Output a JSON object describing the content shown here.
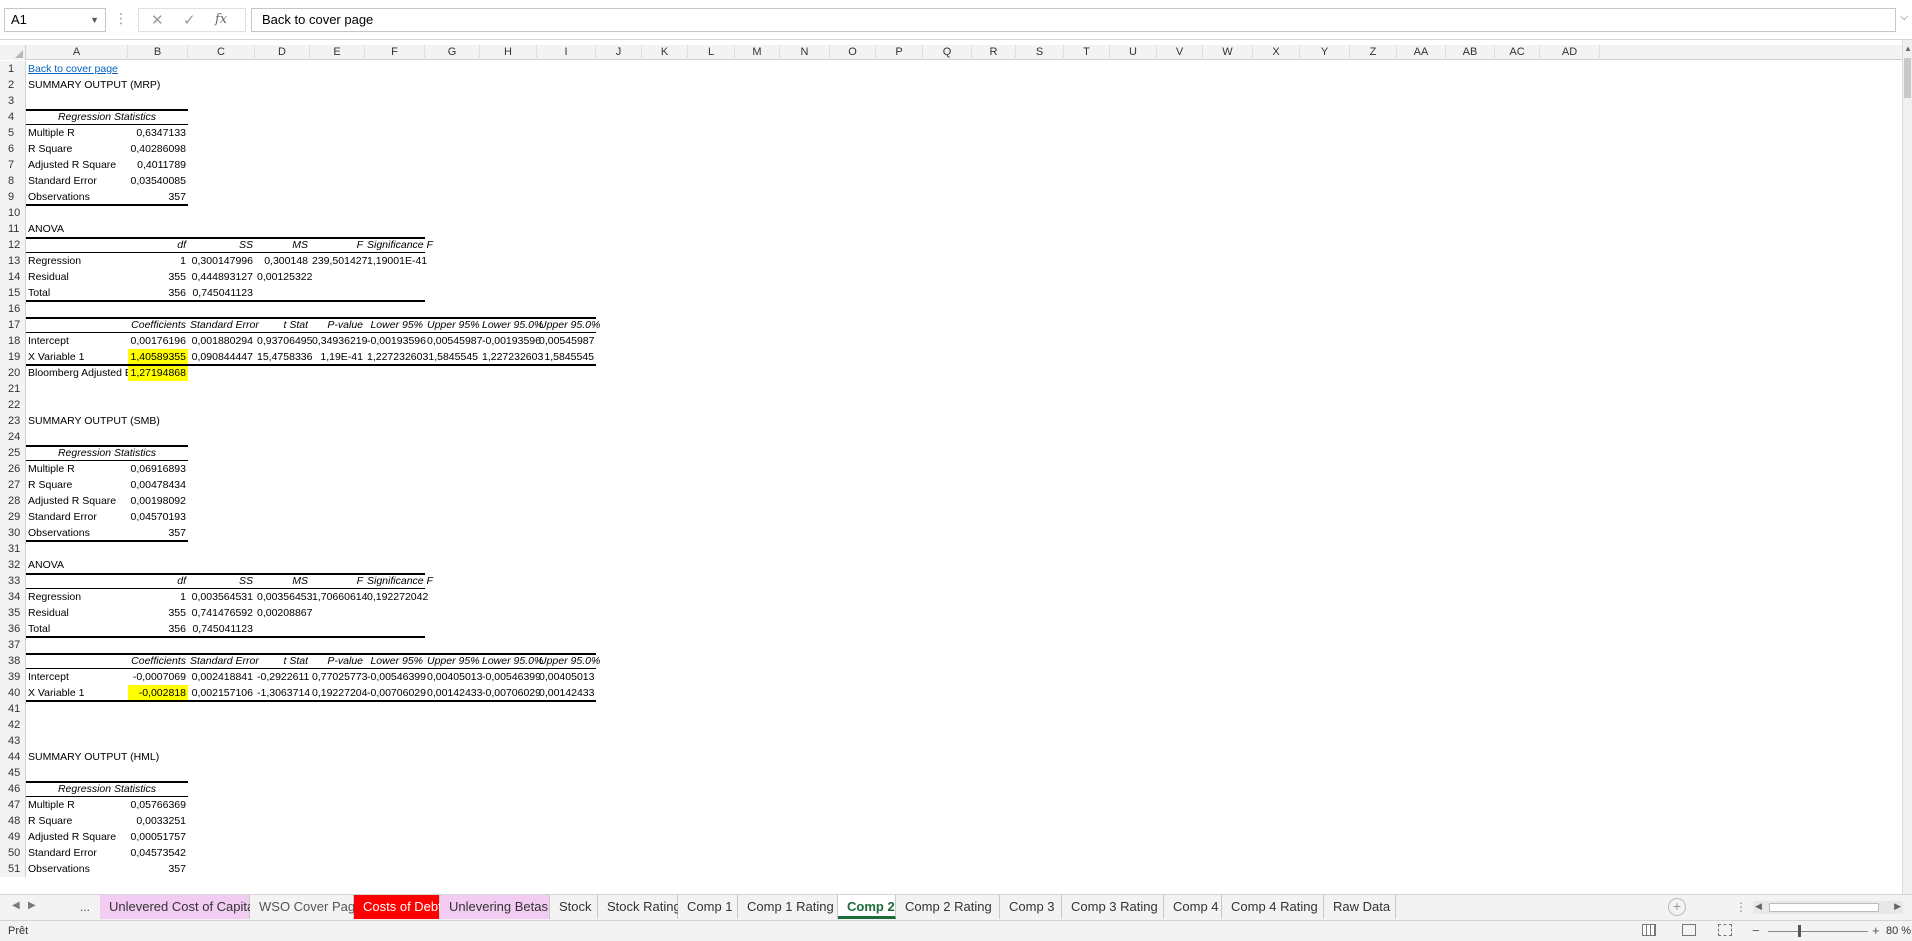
{
  "formula_bar": {
    "name_box": "A1",
    "fx_symbol": "fx",
    "formula": "Back to cover page"
  },
  "columns": [
    "A",
    "B",
    "C",
    "D",
    "E",
    "F",
    "G",
    "H",
    "I",
    "J",
    "K",
    "L",
    "M",
    "N",
    "O",
    "P",
    "Q",
    "R",
    "S",
    "T",
    "U",
    "V",
    "W",
    "X",
    "Y",
    "Z",
    "AA",
    "AB",
    "AC",
    "AD"
  ],
  "rows": [
    "1",
    "2",
    "3",
    "4",
    "5",
    "6",
    "7",
    "8",
    "9",
    "10",
    "11",
    "12",
    "13",
    "14",
    "15",
    "16",
    "17",
    "18",
    "19",
    "20",
    "21",
    "22",
    "23",
    "24",
    "25",
    "26",
    "27",
    "28",
    "29",
    "30",
    "31",
    "32",
    "33",
    "34",
    "35",
    "36",
    "37",
    "38",
    "39",
    "40",
    "41",
    "42",
    "43",
    "44",
    "45",
    "46",
    "47",
    "48",
    "49",
    "50",
    "51"
  ],
  "cells": {
    "A1": "Back to cover page",
    "A2": "SUMMARY OUTPUT (MRP)",
    "A4": "Regression Statistics",
    "A5": "Multiple R",
    "B5": "0,6347133",
    "A6": "R Square",
    "B6": "0,40286098",
    "A7": "Adjusted R Square",
    "B7": "0,4011789",
    "A8": "Standard Error",
    "B8": "0,03540085",
    "A9": "Observations",
    "B9": "357",
    "A11": "ANOVA",
    "B12": "df",
    "C12": "SS",
    "D12": "MS",
    "E12": "F",
    "F12": "Significance F",
    "A13": "Regression",
    "B13": "1",
    "C13": "0,300147996",
    "D13": "0,300148",
    "E13": "239,501427",
    "F13": "1,19001E-41",
    "A14": "Residual",
    "B14": "355",
    "C14": "0,444893127",
    "D14": "0,00125322",
    "A15": "Total",
    "B15": "356",
    "C15": "0,745041123",
    "B17": "Coefficients",
    "C17": "Standard Error",
    "D17": "t Stat",
    "E17": "P-value",
    "F17": "Lower 95%",
    "G17": "Upper 95%",
    "H17": "Lower 95.0%",
    "I17": "Upper 95.0%",
    "A18": "Intercept",
    "B18": "0,00176196",
    "C18": "0,001880294",
    "D18": "0,93706495",
    "E18": "0,34936219",
    "F18": "-0,00193596",
    "G18": "0,00545987",
    "H18": "-0,00193596",
    "I18": "0,00545987",
    "A19": "X Variable 1",
    "B19": "1,40589355",
    "C19": "0,090844447",
    "D19": "15,4758336",
    "E19": "1,19E-41",
    "F19": "1,227232603",
    "G19": "1,5845545",
    "H19": "1,227232603",
    "I19": "1,5845545",
    "A20": "Bloomberg Adjusted Bet",
    "B20": "1,27194868",
    "A23": "SUMMARY OUTPUT (SMB)",
    "A25": "Regression Statistics",
    "A26": "Multiple R",
    "B26": "0,06916893",
    "A27": "R Square",
    "B27": "0,00478434",
    "A28": "Adjusted R Square",
    "B28": "0,00198092",
    "A29": "Standard Error",
    "B29": "0,04570193",
    "A30": "Observations",
    "B30": "357",
    "A32": "ANOVA",
    "B33": "df",
    "C33": "SS",
    "D33": "MS",
    "E33": "F",
    "F33": "Significance F",
    "A34": "Regression",
    "B34": "1",
    "C34": "0,003564531",
    "D34": "0,00356453",
    "E34": "1,70660614",
    "F34": "0,192272042",
    "A35": "Residual",
    "B35": "355",
    "C35": "0,741476592",
    "D35": "0,00208867",
    "A36": "Total",
    "B36": "356",
    "C36": "0,745041123",
    "B38": "Coefficients",
    "C38": "Standard Error",
    "D38": "t Stat",
    "E38": "P-value",
    "F38": "Lower 95%",
    "G38": "Upper 95%",
    "H38": "Lower 95.0%",
    "I38": "Upper 95.0%",
    "A39": "Intercept",
    "B39": "-0,0007069",
    "C39": "0,002418841",
    "D39": "-0,2922611",
    "E39": "0,77025773",
    "F39": "-0,00546399",
    "G39": "0,00405013",
    "H39": "-0,00546399",
    "I39": "0,00405013",
    "A40": "X Variable 1",
    "B40": "-0,002818",
    "C40": "0,002157106",
    "D40": "-1,3063714",
    "E40": "0,19227204",
    "F40": "-0,00706029",
    "G40": "0,00142433",
    "H40": "-0,00706029",
    "I40": "0,00142433",
    "A44": "SUMMARY OUTPUT (HML)",
    "A46": "Regression Statistics",
    "A47": "Multiple R",
    "B47": "0,05766369",
    "A48": "R Square",
    "B48": "0,0033251",
    "A49": "Adjusted R Square",
    "B49": "0,00051757",
    "A50": "Standard Error",
    "B50": "0,04573542",
    "A51": "Observations",
    "B51": "357"
  },
  "highlight_color": "#ffff00",
  "link_color": "#0563c1",
  "tabs": [
    {
      "label": "Unlevered Cost of Capital",
      "bg": "#f2ccf2",
      "fg": "#333333"
    },
    {
      "label": "WSO Cover Page",
      "bg": "#f3f3f3",
      "fg": "#555555"
    },
    {
      "label": "Costs of Debt",
      "bg": "#ff0000",
      "fg": "#ffffff"
    },
    {
      "label": "Unlevering Betas",
      "bg": "#f2ccf2",
      "fg": "#333333"
    },
    {
      "label": "Stock",
      "bg": "#f3f3f3",
      "fg": "#333333"
    },
    {
      "label": "Stock Rating",
      "bg": "#f3f3f3",
      "fg": "#333333"
    },
    {
      "label": "Comp 1",
      "bg": "#f3f3f3",
      "fg": "#333333"
    },
    {
      "label": "Comp 1 Rating",
      "bg": "#f3f3f3",
      "fg": "#333333"
    },
    {
      "label": "Comp 2",
      "bg": "#ffffff",
      "fg": "#1e6b3a",
      "active": true
    },
    {
      "label": "Comp 2 Rating",
      "bg": "#f3f3f3",
      "fg": "#333333"
    },
    {
      "label": "Comp 3",
      "bg": "#f3f3f3",
      "fg": "#333333"
    },
    {
      "label": "Comp 3 Rating",
      "bg": "#f3f3f3",
      "fg": "#333333"
    },
    {
      "label": "Comp 4",
      "bg": "#f3f3f3",
      "fg": "#333333"
    },
    {
      "label": "Comp 4 Rating",
      "bg": "#f3f3f3",
      "fg": "#333333"
    },
    {
      "label": "Raw Data",
      "bg": "#f3f3f3",
      "fg": "#333333"
    }
  ],
  "tab_nav": {
    "more": "..."
  },
  "status": {
    "ready": "Prêt",
    "zoom": "80 %"
  }
}
